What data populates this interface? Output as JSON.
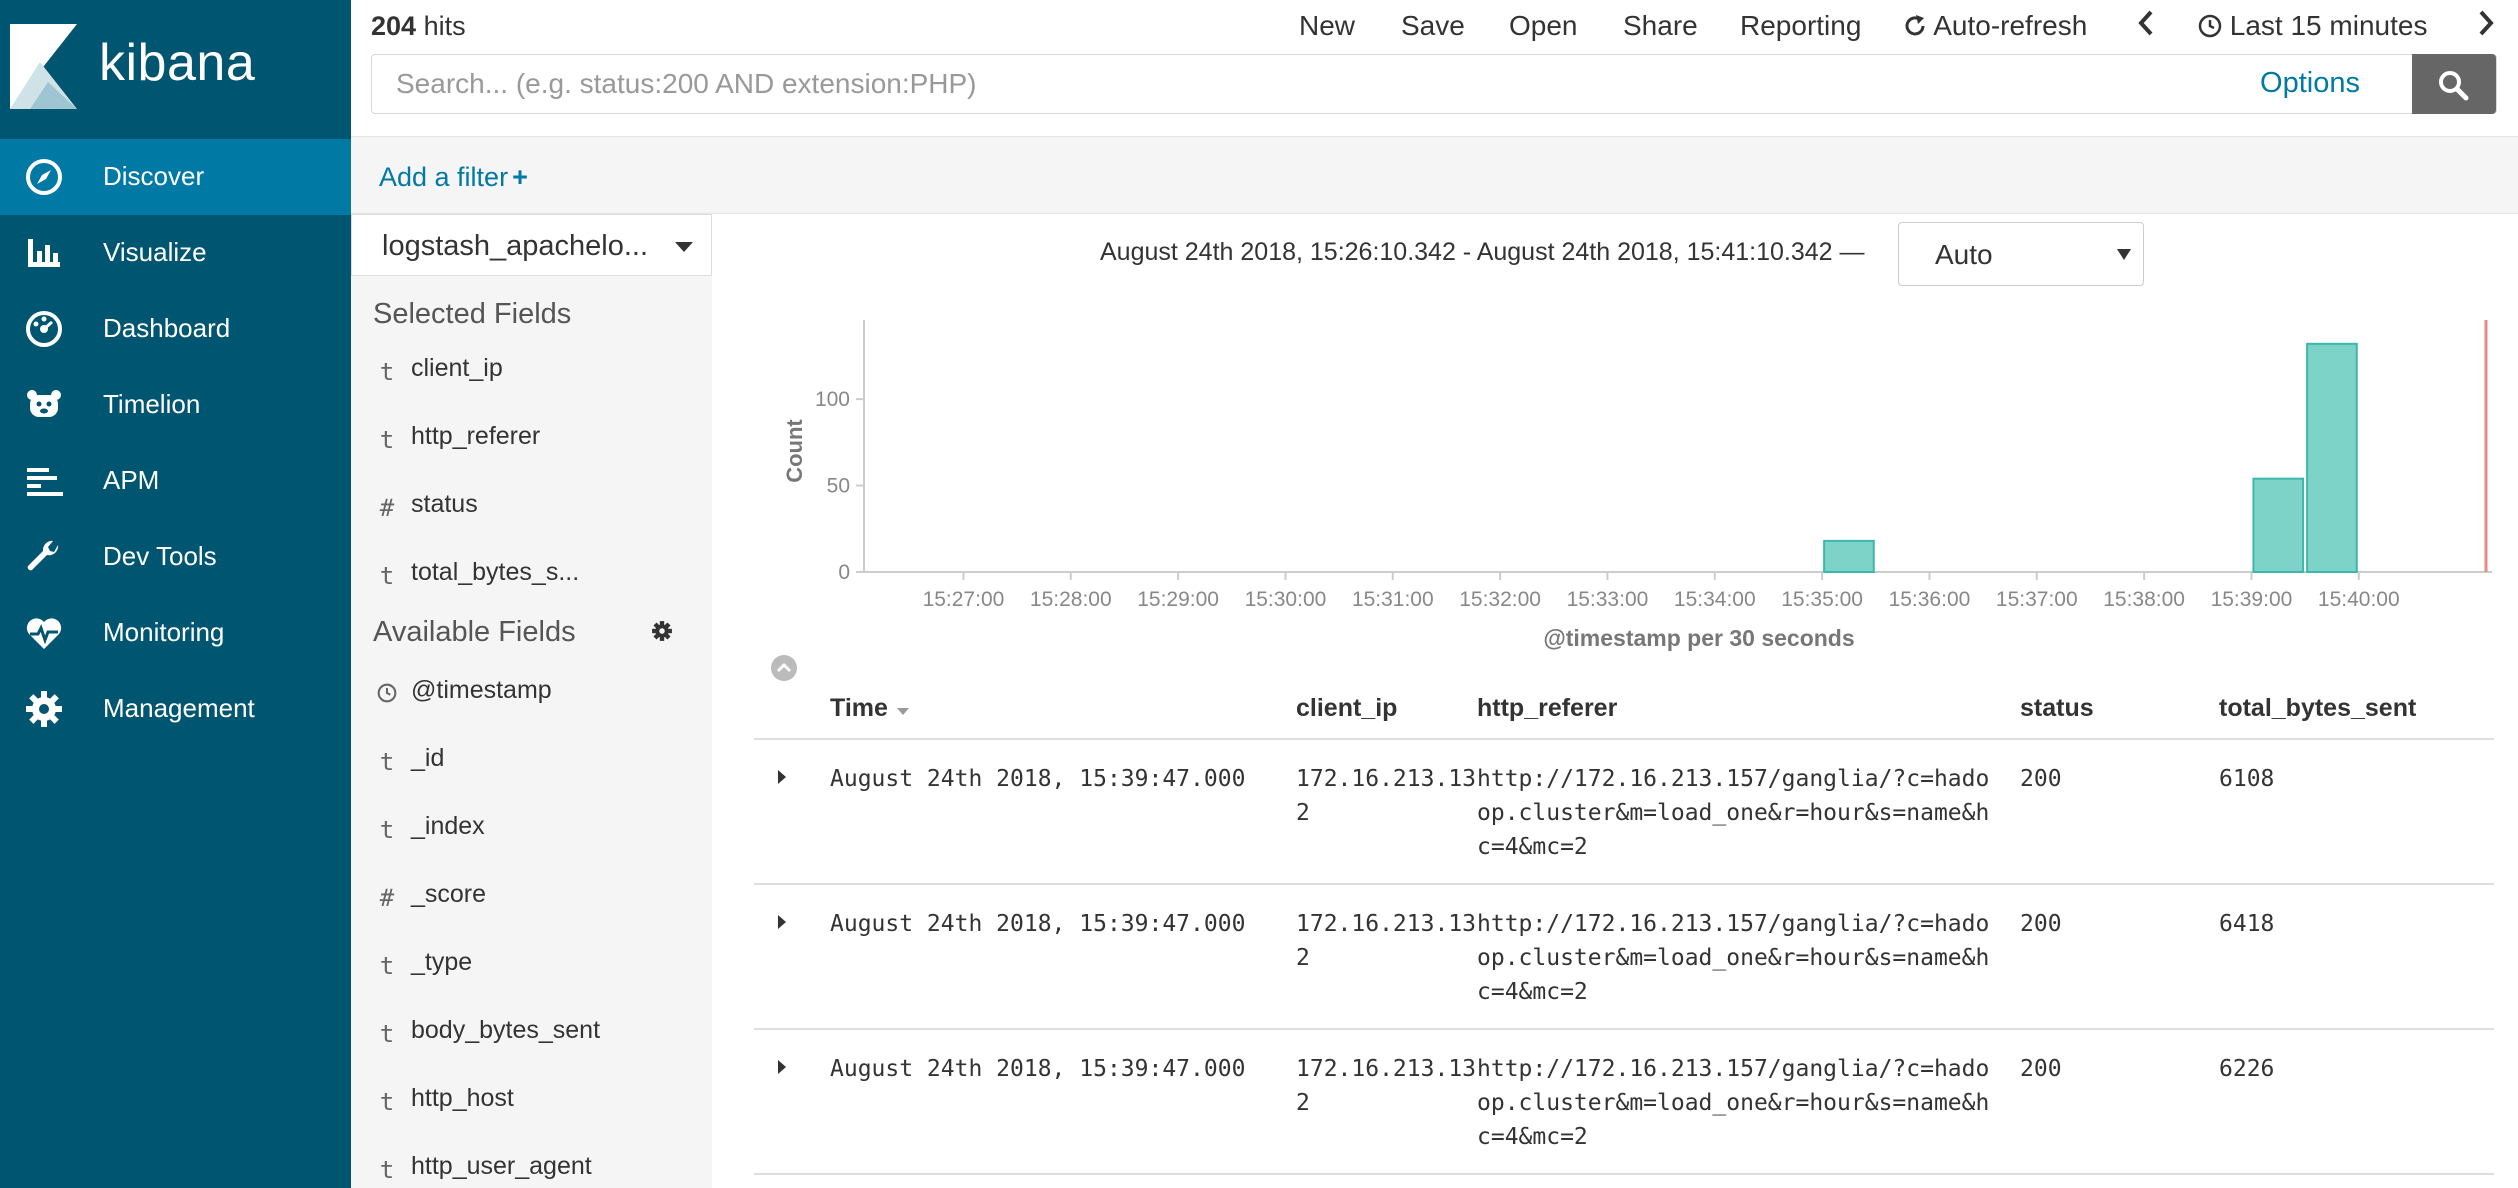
{
  "app": {
    "name": "kibana"
  },
  "sidebar": {
    "items": [
      {
        "label": "Discover",
        "icon": "compass-icon",
        "active": true
      },
      {
        "label": "Visualize",
        "icon": "bar-chart-icon",
        "active": false
      },
      {
        "label": "Dashboard",
        "icon": "dashboard-gauge-icon",
        "active": false
      },
      {
        "label": "Timelion",
        "icon": "timelion-bear-icon",
        "active": false
      },
      {
        "label": "APM",
        "icon": "apm-bars-icon",
        "active": false
      },
      {
        "label": "Dev Tools",
        "icon": "wrench-icon",
        "active": false
      },
      {
        "label": "Monitoring",
        "icon": "heartbeat-icon",
        "active": false
      },
      {
        "label": "Management",
        "icon": "gear-icon",
        "active": false
      }
    ]
  },
  "topbar": {
    "hits_count": "204",
    "hits_label": "hits",
    "menu": {
      "new": "New",
      "save": "Save",
      "open": "Open",
      "share": "Share",
      "reporting": "Reporting",
      "auto_refresh": "Auto-refresh",
      "time_picker": "Last 15 minutes"
    },
    "search": {
      "placeholder": "Search... (e.g. status:200 AND extension:PHP)",
      "value": "",
      "options_label": "Options"
    }
  },
  "filterbar": {
    "add_filter": "Add a filter",
    "add_filter_plus": "+"
  },
  "field_panel": {
    "index_pattern": "logstash_apachelo...",
    "selected_title": "Selected Fields",
    "selected_fields": [
      {
        "type": "t",
        "name": "client_ip"
      },
      {
        "type": "t",
        "name": "http_referer"
      },
      {
        "type": "#",
        "name": "status"
      },
      {
        "type": "t",
        "name": "total_bytes_s..."
      }
    ],
    "available_title": "Available Fields",
    "available_fields": [
      {
        "type": "clock",
        "name": "@timestamp"
      },
      {
        "type": "t",
        "name": "_id"
      },
      {
        "type": "t",
        "name": "_index"
      },
      {
        "type": "#",
        "name": "_score"
      },
      {
        "type": "t",
        "name": "_type"
      },
      {
        "type": "t",
        "name": "body_bytes_sent"
      },
      {
        "type": "t",
        "name": "http_host"
      },
      {
        "type": "t",
        "name": "http_user_agent"
      }
    ]
  },
  "histogram": {
    "time_range": "August 24th 2018, 15:26:10.342 - August 24th 2018, 15:41:10.342 —",
    "interval": "Auto"
  },
  "chart_data": {
    "type": "bar",
    "ylabel": "Count",
    "xlabel": "@timestamp per 30 seconds",
    "ylim": [
      0,
      140
    ],
    "yticks": [
      0,
      50,
      100
    ],
    "xticks": [
      "15:27:00",
      "15:28:00",
      "15:29:00",
      "15:30:00",
      "15:31:00",
      "15:32:00",
      "15:33:00",
      "15:34:00",
      "15:35:00",
      "15:36:00",
      "15:37:00",
      "15:38:00",
      "15:39:00",
      "15:40:00"
    ],
    "categories": [
      "15:35:00",
      "15:39:00",
      "15:39:30"
    ],
    "values": [
      18,
      54,
      132
    ],
    "bar_color": "#7dd3c8",
    "bar_edge_color": "#3fb7a8",
    "now_marker_color": "#e88a8a"
  },
  "doc_table": {
    "columns": [
      "Time",
      "client_ip",
      "http_referer",
      "status",
      "total_bytes_sent"
    ],
    "rows": [
      {
        "time": "August 24th 2018, 15:39:47.000",
        "client_ip": "172.16.213.132",
        "http_referer": "http://172.16.213.157/ganglia/?c=hadoop.cluster&m=load_one&r=hour&s=name&hc=4&mc=2",
        "status": "200",
        "total_bytes_sent": "6108"
      },
      {
        "time": "August 24th 2018, 15:39:47.000",
        "client_ip": "172.16.213.132",
        "http_referer": "http://172.16.213.157/ganglia/?c=hadoop.cluster&m=load_one&r=hour&s=name&hc=4&mc=2",
        "status": "200",
        "total_bytes_sent": "6418"
      },
      {
        "time": "August 24th 2018, 15:39:47.000",
        "client_ip": "172.16.213.132",
        "http_referer": "http://172.16.213.157/ganglia/?c=hadoop.cluster&m=load_one&r=hour&s=name&hc=4&mc=2",
        "status": "200",
        "total_bytes_sent": "6226"
      }
    ]
  }
}
